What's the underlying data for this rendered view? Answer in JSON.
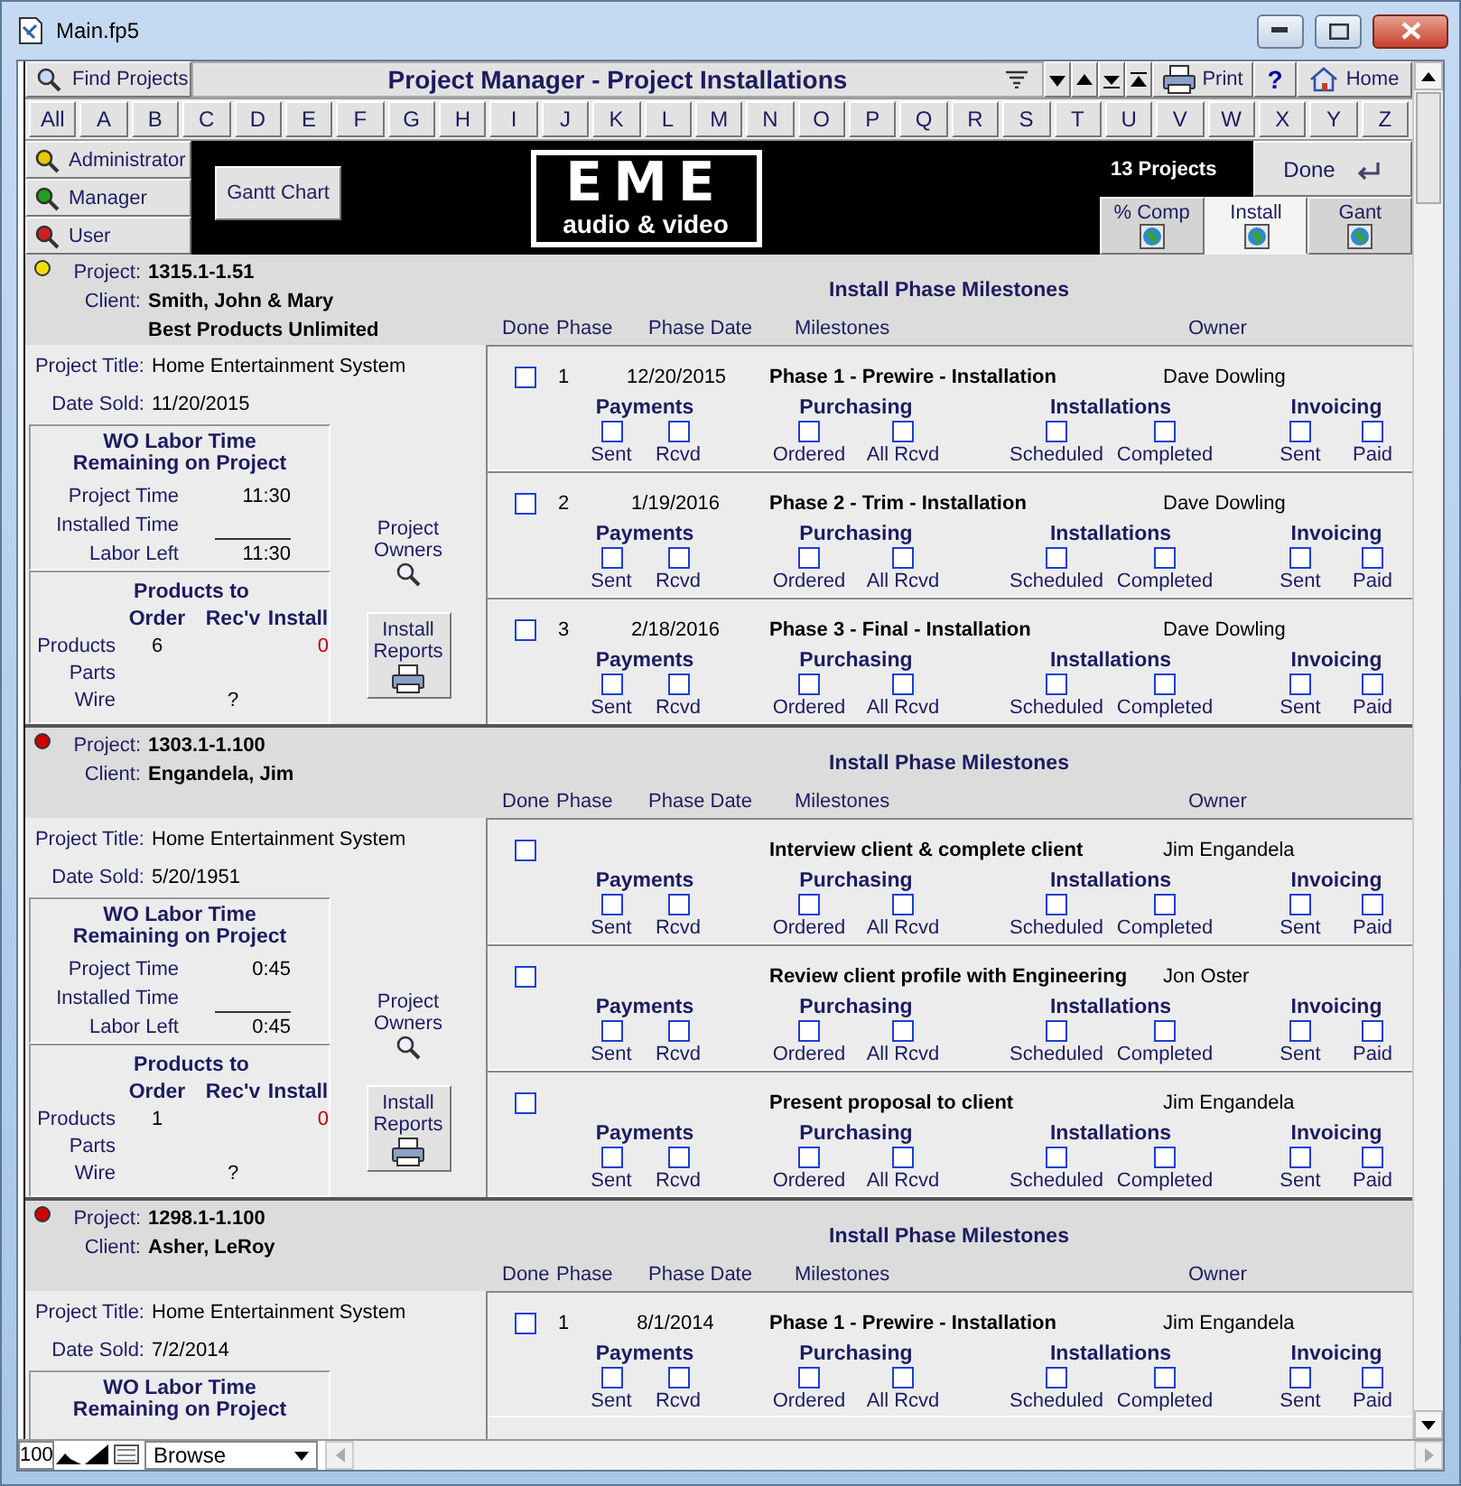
{
  "window": {
    "title": "Main.fp5"
  },
  "toolbar": {
    "find_button": "Find Projects",
    "title": "Project Manager - Project Installations",
    "print_button": "Print",
    "help_button": "?",
    "home_button": "Home"
  },
  "letters": [
    "All",
    "A",
    "B",
    "C",
    "D",
    "E",
    "F",
    "G",
    "H",
    "I",
    "J",
    "K",
    "L",
    "M",
    "N",
    "O",
    "P",
    "Q",
    "R",
    "S",
    "T",
    "U",
    "V",
    "W",
    "X",
    "Y",
    "Z"
  ],
  "role_buttons": [
    {
      "label": "Administrator",
      "color": "#e8c800"
    },
    {
      "label": "Manager",
      "color": "#20a020"
    },
    {
      "label": "User",
      "color": "#d02020"
    }
  ],
  "gantt_button": "Gantt Chart",
  "logo": {
    "mark": "EME",
    "tagline": "audio & video"
  },
  "project_count": "13 Projects",
  "done_button": "Done",
  "view_tabs": [
    {
      "label": "% Comp",
      "selected": false
    },
    {
      "label": "Install",
      "selected": true
    },
    {
      "label": "Gant",
      "selected": false
    }
  ],
  "projects": [
    {
      "color": "#f0e000",
      "project_label": "Project:",
      "number": "1315.1-1.51",
      "client_label": "Client:",
      "client_lines": [
        "Smith, John & Mary",
        "Best Products Unlimited"
      ],
      "milestones_title": "Install Phase Milestones",
      "columns": [
        "Done",
        "Phase",
        "Phase Date",
        "Milestones",
        "Owner"
      ],
      "title_label": "Project Title:",
      "title": "Home Entertainment System",
      "date_label": "Date Sold:",
      "date_sold": "11/20/2015",
      "labor": {
        "heading": [
          "WO Labor Time",
          "Remaining on Project"
        ],
        "rows": [
          {
            "label": "Project Time",
            "value": "11:30"
          },
          {
            "label": "Installed Time"
          },
          {
            "label": "Labor Left",
            "value": "11:30"
          }
        ]
      },
      "products": {
        "heading": "Products to",
        "columns": [
          "Order",
          "Rec'v",
          "Install"
        ],
        "rows": [
          {
            "label": "Products",
            "order": "6",
            "install": "0"
          },
          {
            "label": "Parts"
          },
          {
            "label": "Wire",
            "recv": "?"
          }
        ]
      },
      "owners_label": "Project Owners",
      "reports_button": "Install Reports",
      "phases": [
        {
          "done": false,
          "phase": "1",
          "date": "12/20/2015",
          "milestone": "Phase 1 - Prewire - Installation",
          "owner": "Dave Dowling",
          "groups": [
            {
              "title": "Payments",
              "checks": [
                {
                  "label": "Sent",
                  "checked": false
                },
                {
                  "label": "Rcvd",
                  "checked": false
                }
              ]
            },
            {
              "title": "Purchasing",
              "checks": [
                {
                  "label": "Ordered",
                  "checked": false
                },
                {
                  "label": "All Rcvd",
                  "checked": false
                }
              ]
            },
            {
              "title": "Installations",
              "checks": [
                {
                  "label": "Scheduled",
                  "checked": false
                },
                {
                  "label": "Completed",
                  "checked": false
                }
              ]
            },
            {
              "title": "Invoicing",
              "checks": [
                {
                  "label": "Sent",
                  "checked": false
                },
                {
                  "label": "Paid",
                  "checked": false
                }
              ]
            }
          ]
        },
        {
          "done": false,
          "phase": "2",
          "date": "1/19/2016",
          "milestone": "Phase 2 - Trim - Installation",
          "owner": "Dave Dowling",
          "groups": [
            {
              "title": "Payments",
              "checks": [
                {
                  "label": "Sent",
                  "checked": false
                },
                {
                  "label": "Rcvd",
                  "checked": false
                }
              ]
            },
            {
              "title": "Purchasing",
              "checks": [
                {
                  "label": "Ordered",
                  "checked": false
                },
                {
                  "label": "All Rcvd",
                  "checked": false
                }
              ]
            },
            {
              "title": "Installations",
              "checks": [
                {
                  "label": "Scheduled",
                  "checked": false
                },
                {
                  "label": "Completed",
                  "checked": false
                }
              ]
            },
            {
              "title": "Invoicing",
              "checks": [
                {
                  "label": "Sent",
                  "checked": false
                },
                {
                  "label": "Paid",
                  "checked": false
                }
              ]
            }
          ]
        },
        {
          "done": false,
          "phase": "3",
          "date": "2/18/2016",
          "milestone": "Phase 3 - Final - Installation",
          "owner": "Dave Dowling",
          "groups": [
            {
              "title": "Payments",
              "checks": [
                {
                  "label": "Sent",
                  "checked": false
                },
                {
                  "label": "Rcvd",
                  "checked": false
                }
              ]
            },
            {
              "title": "Purchasing",
              "checks": [
                {
                  "label": "Ordered",
                  "checked": false
                },
                {
                  "label": "All Rcvd",
                  "checked": false
                }
              ]
            },
            {
              "title": "Installations",
              "checks": [
                {
                  "label": "Scheduled",
                  "checked": false
                },
                {
                  "label": "Completed",
                  "checked": false
                }
              ]
            },
            {
              "title": "Invoicing",
              "checks": [
                {
                  "label": "Sent",
                  "checked": false
                },
                {
                  "label": "Paid",
                  "checked": false
                }
              ]
            }
          ]
        }
      ]
    },
    {
      "color": "#d00000",
      "project_label": "Project:",
      "number": "1303.1-1.100",
      "client_label": "Client:",
      "client_lines": [
        "Engandela, Jim"
      ],
      "milestones_title": "Install Phase Milestones",
      "columns": [
        "Done",
        "Phase",
        "Phase Date",
        "Milestones",
        "Owner"
      ],
      "title_label": "Project Title:",
      "title": "Home Entertainment System",
      "date_label": "Date Sold:",
      "date_sold": "5/20/1951",
      "labor": {
        "heading": [
          "WO Labor Time",
          "Remaining on Project"
        ],
        "rows": [
          {
            "label": "Project Time",
            "value": "0:45"
          },
          {
            "label": "Installed Time"
          },
          {
            "label": "Labor Left",
            "value": "0:45"
          }
        ]
      },
      "products": {
        "heading": "Products to",
        "columns": [
          "Order",
          "Rec'v",
          "Install"
        ],
        "rows": [
          {
            "label": "Products",
            "order": "1",
            "install": "0"
          },
          {
            "label": "Parts"
          },
          {
            "label": "Wire",
            "recv": "?"
          }
        ]
      },
      "owners_label": "Project Owners",
      "reports_button": "Install Reports",
      "phases": [
        {
          "done": false,
          "milestone": "Interview client & complete client",
          "owner": "Jim Engandela",
          "groups": [
            {
              "title": "Payments",
              "checks": [
                {
                  "label": "Sent",
                  "checked": false
                },
                {
                  "label": "Rcvd",
                  "checked": false
                }
              ]
            },
            {
              "title": "Purchasing",
              "checks": [
                {
                  "label": "Ordered",
                  "checked": false
                },
                {
                  "label": "All Rcvd",
                  "checked": false
                }
              ]
            },
            {
              "title": "Installations",
              "checks": [
                {
                  "label": "Scheduled",
                  "checked": false
                },
                {
                  "label": "Completed",
                  "checked": false
                }
              ]
            },
            {
              "title": "Invoicing",
              "checks": [
                {
                  "label": "Sent",
                  "checked": false
                },
                {
                  "label": "Paid",
                  "checked": false
                }
              ]
            }
          ]
        },
        {
          "done": false,
          "milestone": "Review client profile with Engineering",
          "owner": "Jon Oster",
          "groups": [
            {
              "title": "Payments",
              "checks": [
                {
                  "label": "Sent",
                  "checked": false
                },
                {
                  "label": "Rcvd",
                  "checked": false
                }
              ]
            },
            {
              "title": "Purchasing",
              "checks": [
                {
                  "label": "Ordered",
                  "checked": false
                },
                {
                  "label": "All Rcvd",
                  "checked": false
                }
              ]
            },
            {
              "title": "Installations",
              "checks": [
                {
                  "label": "Scheduled",
                  "checked": false
                },
                {
                  "label": "Completed",
                  "checked": false
                }
              ]
            },
            {
              "title": "Invoicing",
              "checks": [
                {
                  "label": "Sent",
                  "checked": false
                },
                {
                  "label": "Paid",
                  "checked": false
                }
              ]
            }
          ]
        },
        {
          "done": false,
          "milestone": "Present proposal to client",
          "owner": "Jim Engandela",
          "groups": [
            {
              "title": "Payments",
              "checks": [
                {
                  "label": "Sent",
                  "checked": false
                },
                {
                  "label": "Rcvd",
                  "checked": false
                }
              ]
            },
            {
              "title": "Purchasing",
              "checks": [
                {
                  "label": "Ordered",
                  "checked": false
                },
                {
                  "label": "All Rcvd",
                  "checked": false
                }
              ]
            },
            {
              "title": "Installations",
              "checks": [
                {
                  "label": "Scheduled",
                  "checked": false
                },
                {
                  "label": "Completed",
                  "checked": false
                }
              ]
            },
            {
              "title": "Invoicing",
              "checks": [
                {
                  "label": "Sent",
                  "checked": false
                },
                {
                  "label": "Paid",
                  "checked": false
                }
              ]
            }
          ]
        }
      ]
    },
    {
      "color": "#d00000",
      "project_label": "Project:",
      "number": "1298.1-1.100",
      "client_label": "Client:",
      "client_lines": [
        "Asher, LeRoy"
      ],
      "milestones_title": "Install Phase Milestones",
      "columns": [
        "Done",
        "Phase",
        "Phase Date",
        "Milestones",
        "Owner"
      ],
      "title_label": "Project Title:",
      "title": "Home Entertainment System",
      "date_label": "Date Sold:",
      "date_sold": "7/2/2014",
      "labor": {
        "heading": [
          "WO Labor Time",
          "Remaining on Project"
        ]
      },
      "phases": [
        {
          "done": false,
          "phase": "1",
          "date": "8/1/2014",
          "milestone": "Phase 1 - Prewire - Installation",
          "owner": "Jim Engandela",
          "groups": [
            {
              "title": "Payments",
              "checks": [
                {
                  "label": "Sent",
                  "checked": false
                },
                {
                  "label": "Rcvd",
                  "checked": false
                }
              ]
            },
            {
              "title": "Purchasing",
              "checks": [
                {
                  "label": "Ordered",
                  "checked": false
                },
                {
                  "label": "All Rcvd",
                  "checked": false
                }
              ]
            },
            {
              "title": "Installations",
              "checks": [
                {
                  "label": "Scheduled",
                  "checked": false
                },
                {
                  "label": "Completed",
                  "checked": false
                }
              ]
            },
            {
              "title": "Invoicing",
              "checks": [
                {
                  "label": "Sent",
                  "checked": false
                },
                {
                  "label": "Paid",
                  "checked": false
                }
              ]
            }
          ]
        }
      ]
    }
  ],
  "status_bar": {
    "zoom": "100",
    "mode": "Browse"
  }
}
